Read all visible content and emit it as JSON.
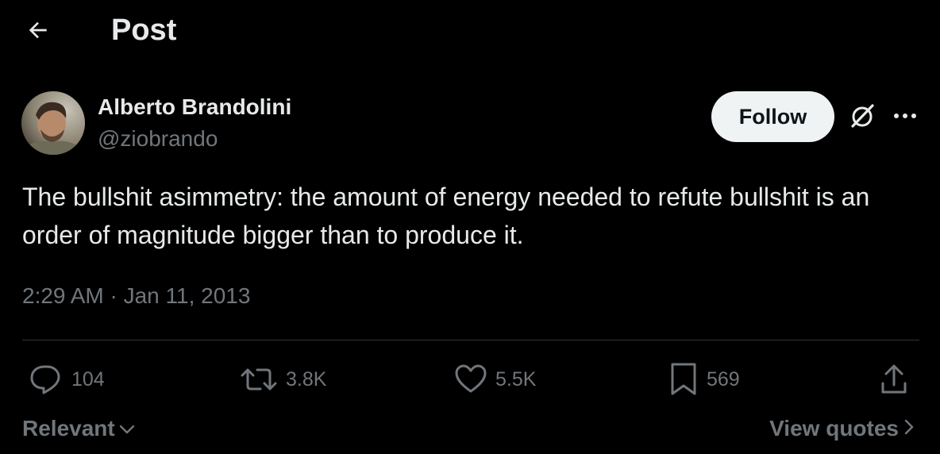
{
  "header": {
    "back_icon": "arrow-left-icon",
    "title": "Post"
  },
  "author": {
    "name": "Alberto Brandolini",
    "handle": "@ziobrando",
    "avatar_icon": "avatar-photo"
  },
  "actions_top": {
    "follow_label": "Follow",
    "grok_icon": "grok-icon",
    "more_icon": "more-icon"
  },
  "post": {
    "text": "The bullshit asimmetry: the amount of energy needed to refute bullshit is an order of magnitude bigger than to produce it.",
    "timestamp": "2:29 AM · Jan 11, 2013"
  },
  "stats": {
    "replies": "104",
    "reposts": "3.8K",
    "likes": "5.5K",
    "bookmarks": "569"
  },
  "footer": {
    "sort_label": "Relevant",
    "view_quotes_label": "View quotes"
  },
  "colors": {
    "background": "#000000",
    "text_primary": "#e7e9ea",
    "text_secondary": "#71767b",
    "divider": "#2f3336",
    "follow_bg": "#eff3f4"
  }
}
